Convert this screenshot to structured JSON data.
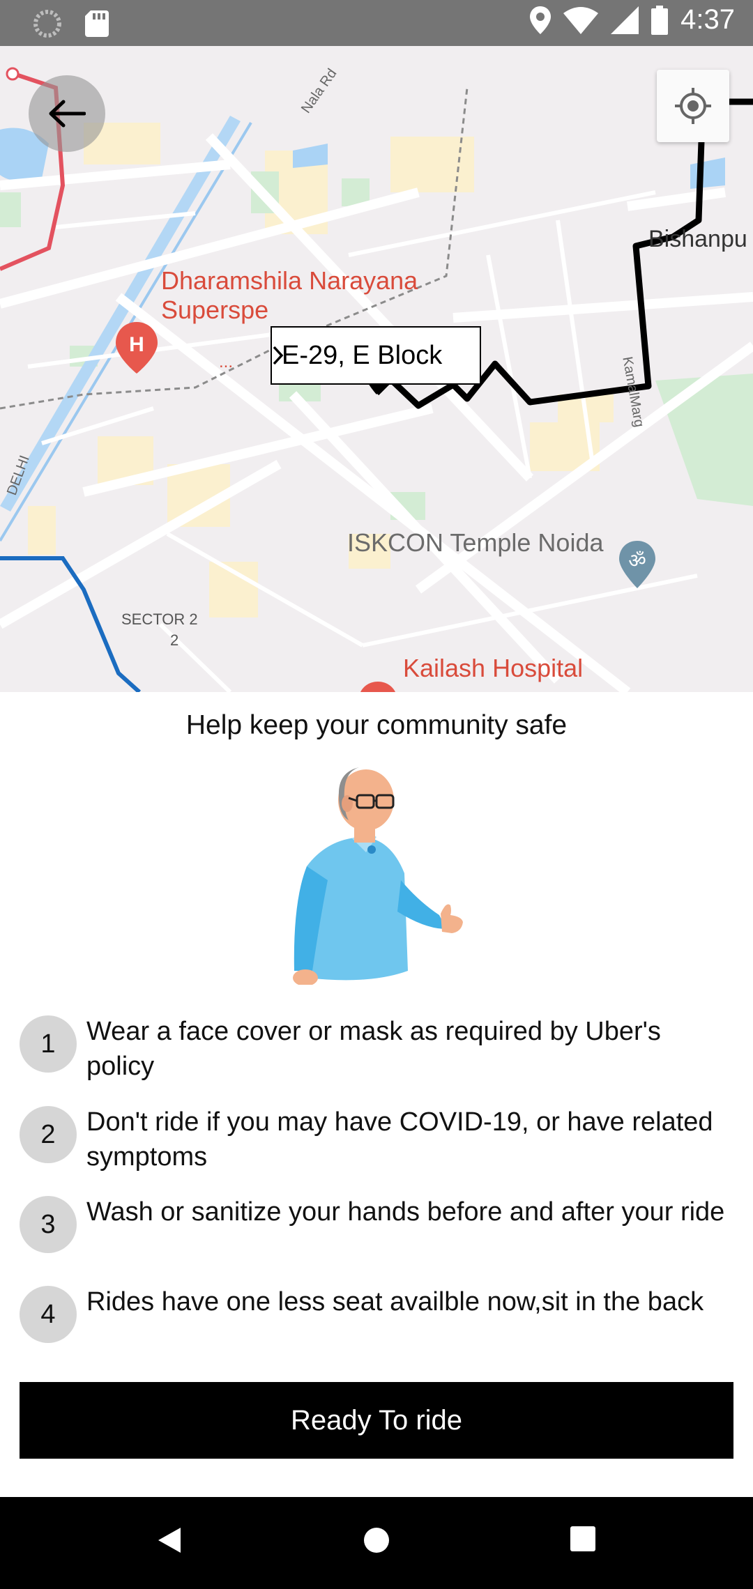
{
  "status_bar": {
    "time": "4:37",
    "icons": [
      "loading-circle-icon",
      "sd-card-icon",
      "location-pin-icon",
      "wifi-icon",
      "signal-icon",
      "battery-icon"
    ]
  },
  "map": {
    "labels": {
      "nala_rd": "Nala Rd",
      "dharamshila_line1": "Dharamshila Narayana",
      "dharamshila_line2": "Superspe",
      "dharamshila_more": "...",
      "bishanpur": "Bishanpu",
      "kamal_marg": "KamalMarg",
      "iskcon": "ISKCON Temple Noida",
      "sector": "SECTOR 2",
      "sector_num": "2",
      "kailash": "Kailash Hospital",
      "delhi": "DELHI"
    },
    "pickup_label": "E-29, E Block"
  },
  "sheet": {
    "title": "Help keep your community safe",
    "steps": [
      {
        "number": "1",
        "text": "Wear a face cover or mask as required by Uber's policy"
      },
      {
        "number": "2",
        "text": "Don't ride if you may have COVID-19, or have related symptoms"
      },
      {
        "number": "3",
        "text": "Wash or sanitize your hands before and after your ride"
      },
      {
        "number": "4",
        "text": "Rides have one less seat availble now,sit in the back"
      }
    ],
    "button_label": "Ready To ride"
  },
  "colors": {
    "accent_button": "#000000",
    "status_bar": "#757575",
    "poi_red": "#d94b3b",
    "route": "#000000"
  }
}
